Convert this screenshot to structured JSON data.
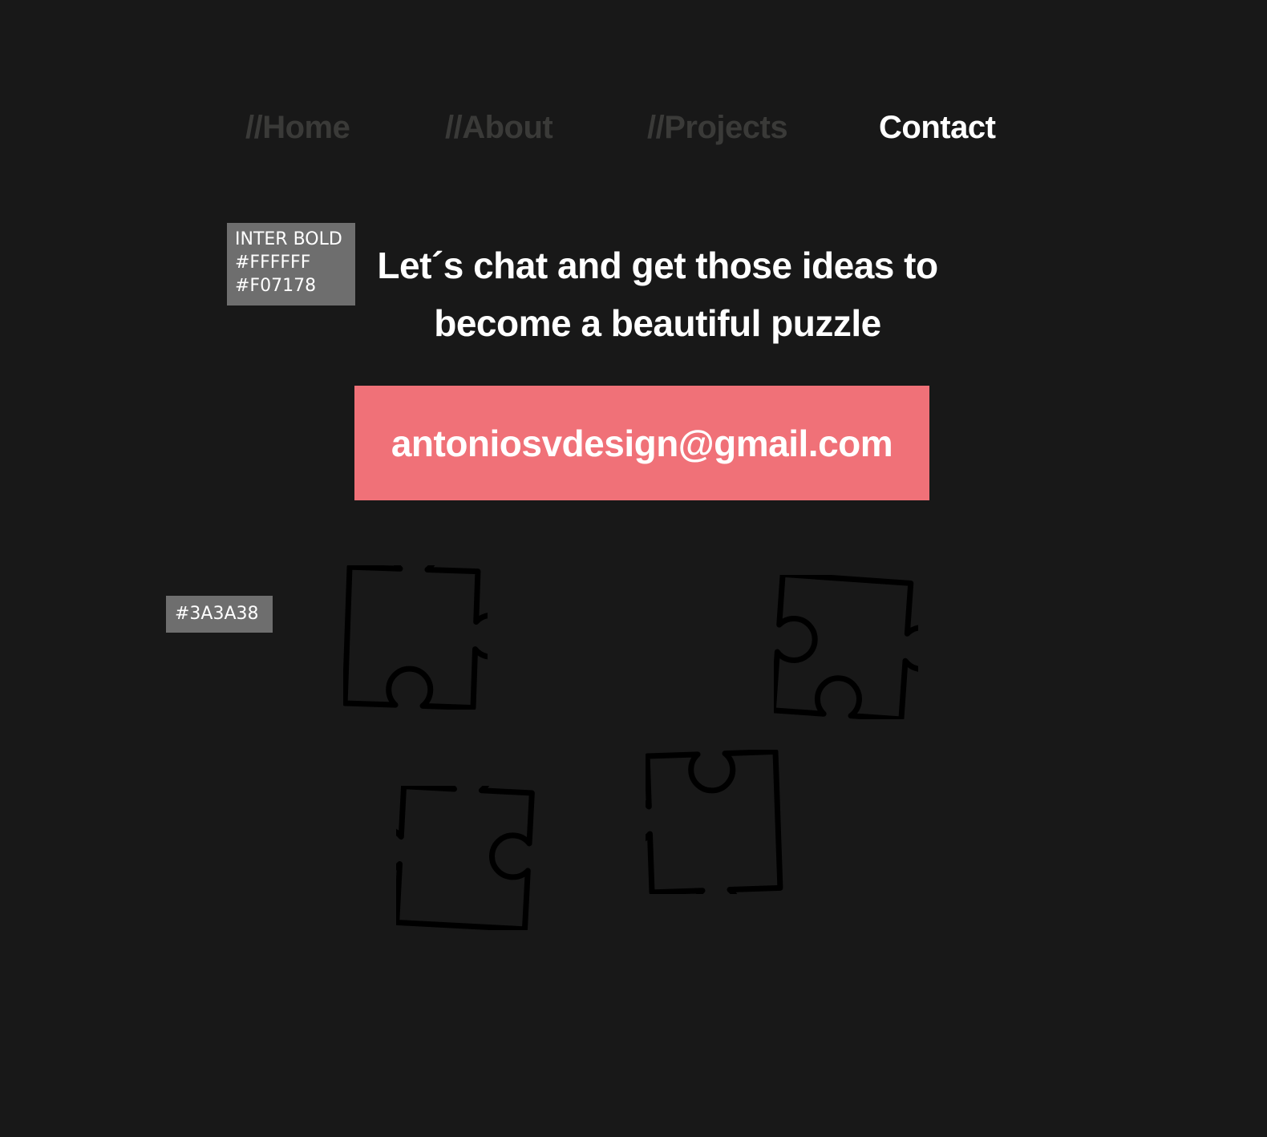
{
  "nav": {
    "home": "//Home",
    "about": "//About",
    "projects": "//Projects",
    "contact": "Contact"
  },
  "style_note": {
    "line1": "INTER BOLD",
    "line2": "#FFFFFF",
    "line3": "#F07178"
  },
  "color_note": "#3A3A38",
  "headline": {
    "line1": "Let´s chat and get those ideas to",
    "line2": "become a beautiful puzzle"
  },
  "email": "antoniosvdesign@gmail.com",
  "colors": {
    "background": "#181818",
    "text": "#FFFFFF",
    "accent": "#F07178",
    "muted": "#3A3A38"
  },
  "decorations": [
    "puzzle-piece-icon",
    "puzzle-piece-icon",
    "puzzle-piece-icon",
    "puzzle-piece-icon"
  ]
}
